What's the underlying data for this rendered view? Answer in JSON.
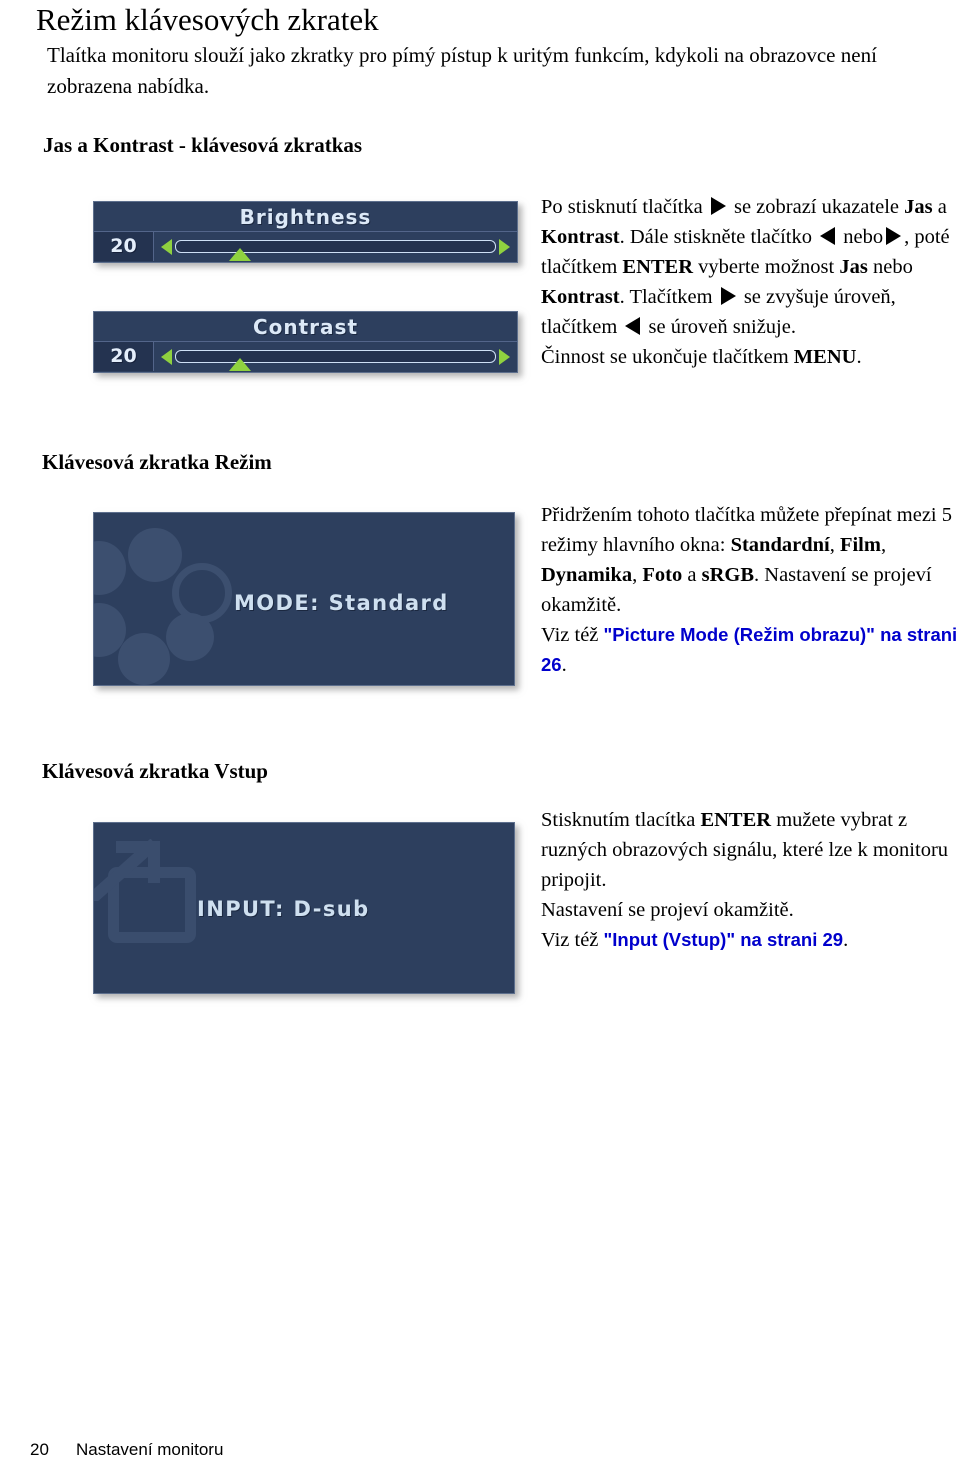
{
  "page": {
    "title": "Režim klávesových zkratek",
    "intro": "Tlaítka monitoru slouží jako zkratky pro pímý pístup k uritým funkcím, kdykoli na obrazovce není zobrazena nabídka."
  },
  "sections": {
    "brightness_contrast": {
      "heading": "Jas a Kontrast  - klávesová zkratkas",
      "osd": [
        {
          "name": "Brightness",
          "title": "Brightness",
          "value": "20",
          "percent": 20
        },
        {
          "name": "Contrast",
          "title": "Contrast",
          "value": "20",
          "percent": 20
        }
      ],
      "text_parts": {
        "p1a": "Po stisknutí tlačítka",
        "p1b": "se zobrazí ukazatele",
        "jas": "Jas",
        "a": " a ",
        "kontrast": "Kontrast",
        "p2": ". Dále stiskněte tlačítko",
        "p3": "nebo",
        "p4": ", poté tlačítkem",
        "enter": "ENTER",
        "p5": "vyberte možnost",
        "p6": "nebo",
        "p7": ". Tlačítkem",
        "p8": "se zvyšuje úroveň, tlačítkem",
        "p9": "se úroveň snižuje.",
        "p10": "Činnost se ukončuje tlačítkem",
        "menu": "MENU",
        "p11": "."
      }
    },
    "mode": {
      "heading": "Klávesová zkratka Režim",
      "osd_label": "MODE: Standard",
      "text_parts": {
        "p1": "Přidržením tohoto tlačítka můžete přepínat mezi 5 režimy hlavního okna: ",
        "m1": "Standardní",
        "sep1": ", ",
        "m2": "Film",
        "sep2": ", ",
        "m3": "Dynamika",
        "sep3": ", ",
        "m4": "Foto",
        "sep4": " a ",
        "m5": "sRGB",
        "p2": ". Nastavení se projeví okamžitě.",
        "p3": "Viz též ",
        "link": "\"Picture Mode (Režim obrazu)\" na strani 26",
        "p4": "."
      }
    },
    "input": {
      "heading": "Klávesová zkratka Vstup",
      "osd_label": "INPUT: D-sub",
      "text_parts": {
        "p1": "Stisknutím tlacítka ",
        "enter": "ENTER",
        "p2": " mužete vybrat z ruzných obrazových signálu, které lze k monitoru pripojit.",
        "p3": "Nastavení se projeví okamžitě.",
        "p4": "Viz též ",
        "link": "\"Input (Vstup)\" na strani 29",
        "p5": "."
      }
    }
  },
  "footer": {
    "page_number": "20",
    "section_name": "Nastavení monitoru"
  },
  "colors": {
    "osd_background": "#2d3f5e",
    "osd_border": "#5d6f8d",
    "osd_text": "#dce9f7",
    "osd_accent_green": "#8fd13f",
    "link_blue": "#0000cc",
    "deco": "#3c4f6f"
  }
}
